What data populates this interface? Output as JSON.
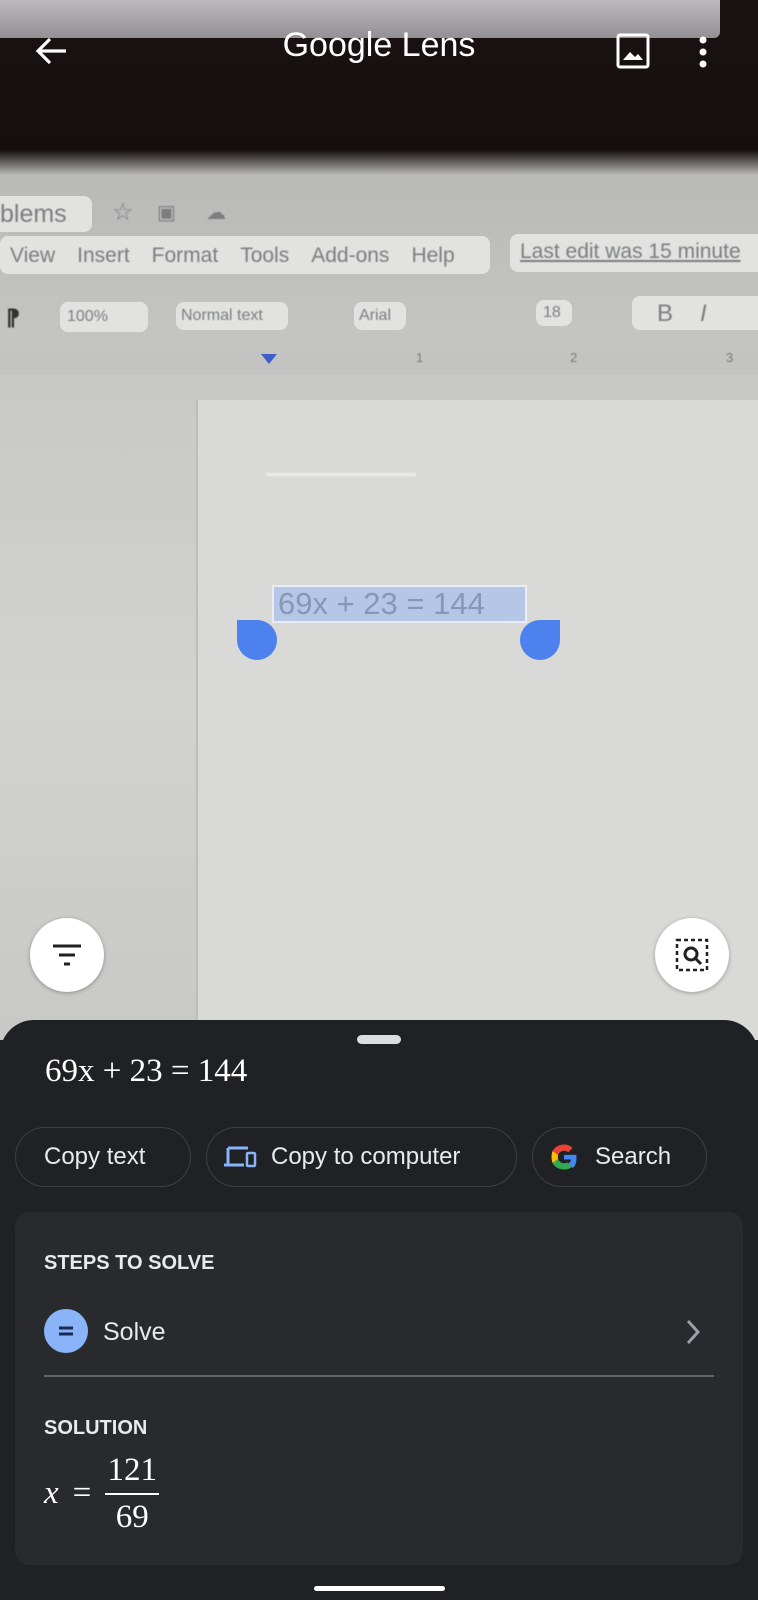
{
  "header": {
    "title": "Google Lens",
    "back_icon": "arrow-back-icon",
    "gallery_icon": "image-icon",
    "menu_icon": "more-vert-icon"
  },
  "camera": {
    "doc_title": "blems",
    "menu": [
      "View",
      "Insert",
      "Format",
      "Tools",
      "Add-ons",
      "Help"
    ],
    "last_edit": "Last edit was 15 minute",
    "toolbar": {
      "zoom": "100%",
      "style": "Normal text",
      "font": "Arial",
      "size": "18",
      "bold": "B",
      "italic": "I"
    },
    "ruler": [
      "1",
      "2",
      "3"
    ],
    "selected_text": "69x + 23 = 144"
  },
  "fabs": {
    "filter_icon": "filter-icon",
    "lens_icon": "search-region-icon"
  },
  "sheet": {
    "equation": "69x + 23 = 144",
    "chips": [
      {
        "label": "Copy text"
      },
      {
        "label": "Copy to computer",
        "icon": "devices-icon"
      },
      {
        "label": "Search",
        "icon": "google-g-icon"
      }
    ],
    "steps_title": "STEPS TO SOLVE",
    "solve_label": "Solve",
    "solution_title": "SOLUTION",
    "solution": {
      "var": "x",
      "eq": "=",
      "numerator": "121",
      "denominator": "69"
    }
  },
  "colors": {
    "accent": "#8ab4f8",
    "selection_handle": "#4d82ee",
    "sheet_bg": "#202124",
    "card_bg": "#292a2d"
  }
}
